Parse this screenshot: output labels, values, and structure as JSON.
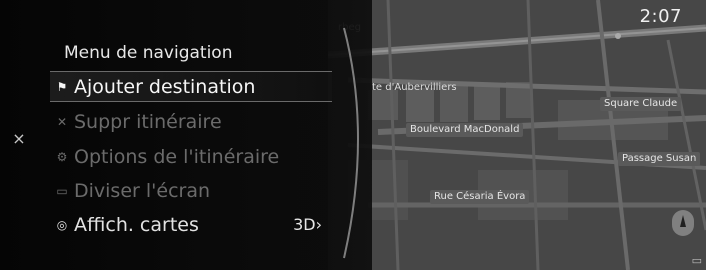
{
  "status": {
    "time": "2:07"
  },
  "menu": {
    "title": "Menu de navigation",
    "close_glyph": "×",
    "items": [
      {
        "label": "Ajouter destination",
        "state": "selected",
        "icon": "flag-icon",
        "glyph": "⚑"
      },
      {
        "label": "Suppr itinéraire",
        "state": "disabled",
        "icon": "remove-route-icon",
        "glyph": "✕"
      },
      {
        "label": "Options de l'itinéraire",
        "state": "disabled",
        "icon": "route-options-icon",
        "glyph": "⚙"
      },
      {
        "label": "Diviser l'écran",
        "state": "disabled",
        "icon": "split-screen-icon",
        "glyph": "▭"
      },
      {
        "label": "Affich. cartes",
        "state": "enabled",
        "icon": "map-view-icon",
        "glyph": "◎",
        "value": "3D›"
      }
    ]
  },
  "map": {
    "labels": [
      "rbeg",
      "te d'Aubervilliers",
      "Boulevard MacDonald",
      "Square Claude",
      "Passage Susan",
      "Rue Césaria Évora"
    ],
    "bottom_icon": "map-menu-icon",
    "bottom_glyph": "▭"
  },
  "colors": {
    "panel_bg": "#0a0a0a",
    "map_bg": "#4a4a4a",
    "text_primary": "#e8e8e8",
    "text_disabled": "#6b6b6b",
    "arc": "#9a9a9a"
  }
}
